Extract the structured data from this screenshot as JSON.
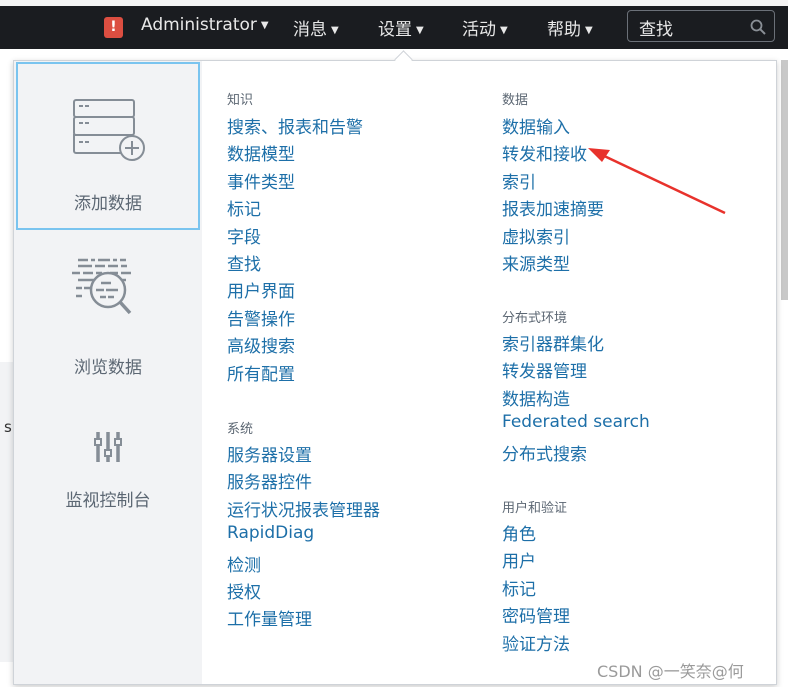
{
  "nav": {
    "alert_icon": "!",
    "user": "Administrator",
    "messages": "消息",
    "settings": "设置",
    "activity": "活动",
    "help": "帮助",
    "search_placeholder": "查找"
  },
  "background": {
    "text": "s t"
  },
  "left_panel": [
    {
      "label": "添加数据",
      "icon": "add-data-icon",
      "selected": true
    },
    {
      "label": "浏览数据",
      "icon": "explore-data-icon"
    },
    {
      "label": "监视控制台",
      "icon": "sliders-icon"
    }
  ],
  "col1": {
    "knowledge_header": "知识",
    "knowledge": [
      "搜索、报表和告警",
      "数据模型",
      "事件类型",
      "标记",
      "字段",
      "查找",
      "用户界面",
      "告警操作",
      "高级搜索",
      "所有配置"
    ],
    "system_header": "系统",
    "system": [
      "服务器设置",
      "服务器控件",
      "运行状况报表管理器",
      "RapidDiag",
      "检测",
      "授权",
      "工作量管理"
    ]
  },
  "col2": {
    "data_header": "数据",
    "data": [
      "数据输入",
      "转发和接收",
      "索引",
      "报表加速摘要",
      "虚拟索引",
      "来源类型"
    ],
    "distributed_header": "分布式环境",
    "distributed": [
      "索引器群集化",
      "转发器管理",
      "数据构造",
      "Federated search",
      "分布式搜索"
    ],
    "auth_header": "用户和验证",
    "auth": [
      "角色",
      "用户",
      "标记",
      "密码管理",
      "验证方法"
    ]
  },
  "annotation": {
    "arrow_color": "#e8322c"
  },
  "watermark": "CSDN @一笑奈@何"
}
